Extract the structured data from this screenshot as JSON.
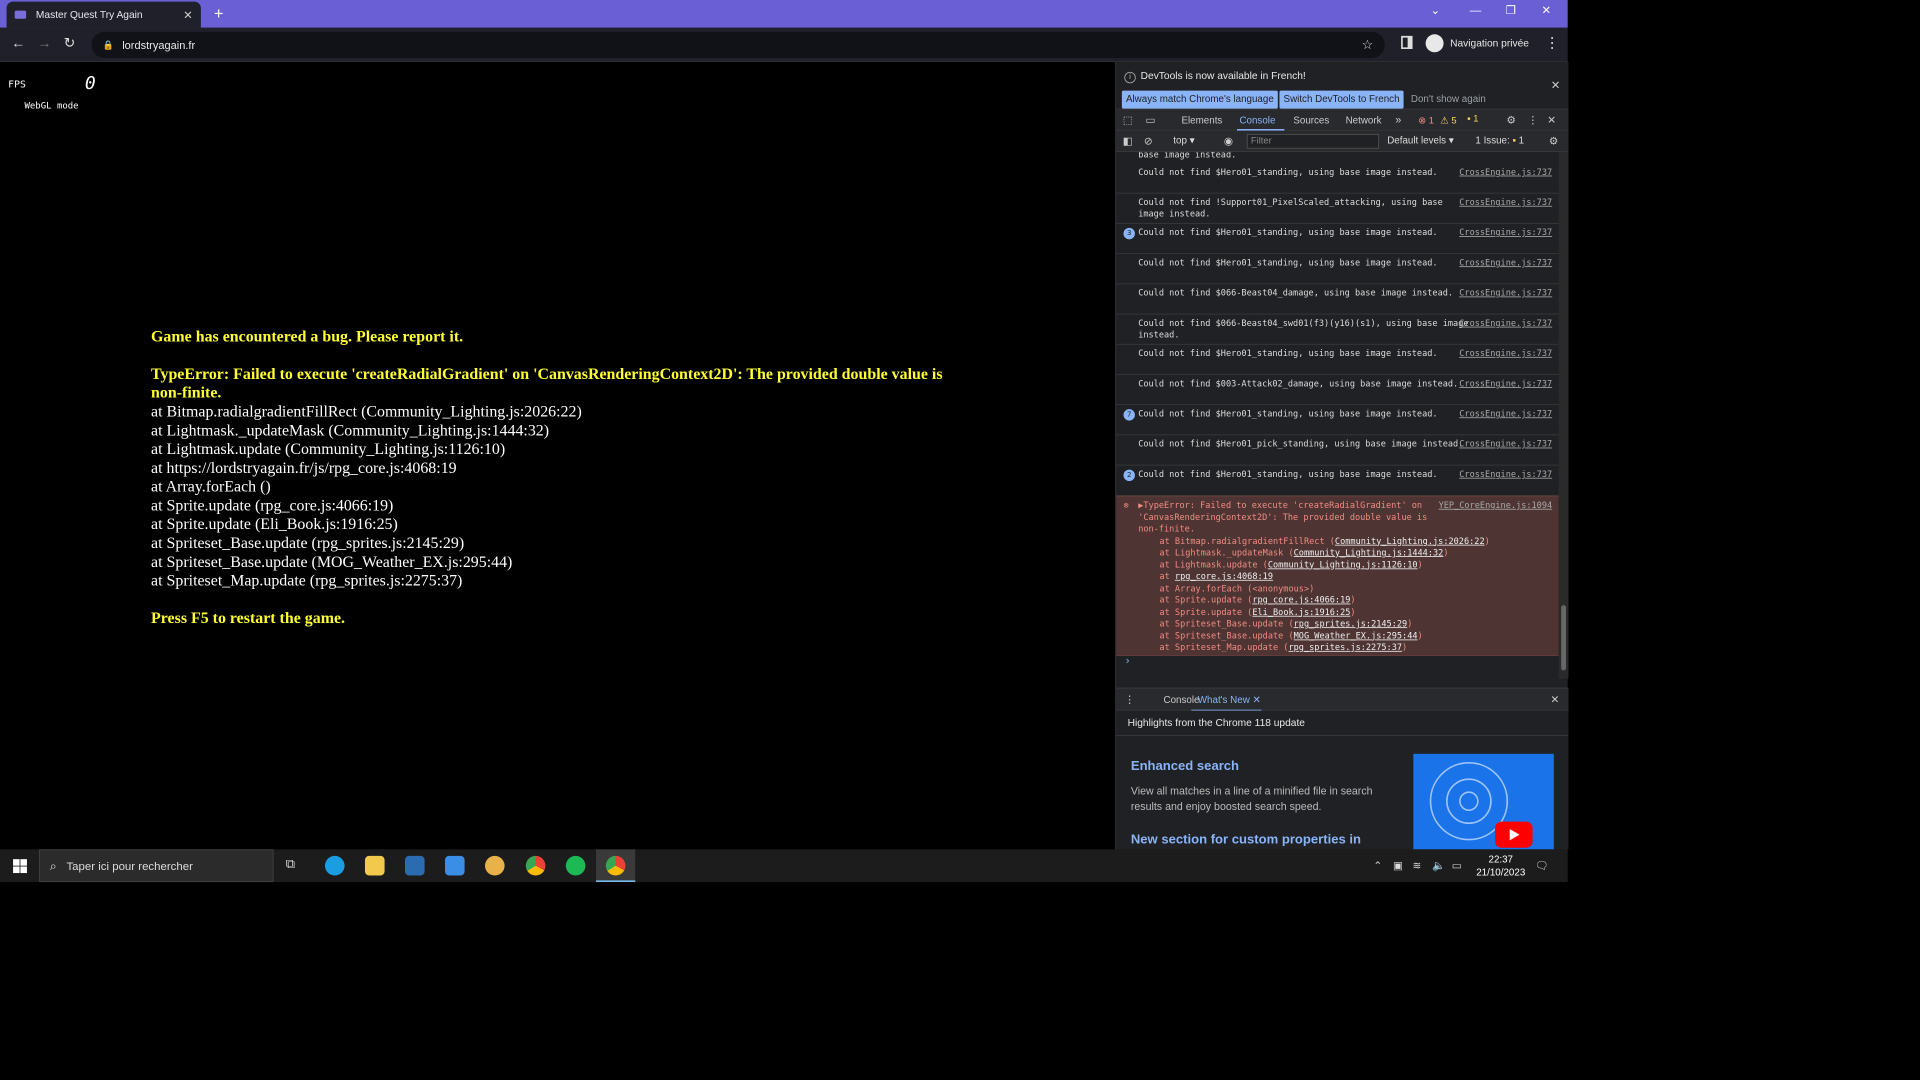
{
  "browser": {
    "tab_title": "Master Quest Try Again",
    "url": "lordstryagain.fr",
    "private_label": "Navigation privée"
  },
  "game": {
    "fps_label": "FPS",
    "fps_value": "0",
    "mode": "WebGL mode",
    "error_heading": "Game has encountered a bug. Please report it.",
    "error_message": "TypeError: Failed to execute 'createRadialGradient' on 'CanvasRenderingContext2D': The provided double value is non-finite.",
    "stack": [
      "at Bitmap.radialgradientFillRect (Community_Lighting.js:2026:22)",
      "at Lightmask._updateMask (Community_Lighting.js:1444:32)",
      "at Lightmask.update (Community_Lighting.js:1126:10)",
      "at https://lordstryagain.fr/js/rpg_core.js:4068:19",
      "at Array.forEach ()",
      "at Sprite.update (rpg_core.js:4066:19)",
      "at Sprite.update (Eli_Book.js:1916:25)",
      "at Spriteset_Base.update (rpg_sprites.js:2145:29)",
      "at Spriteset_Base.update (MOG_Weather_EX.js:295:44)",
      "at Spriteset_Map.update (rpg_sprites.js:2275:37)"
    ],
    "restart_msg": "Press F5 to restart the game."
  },
  "devtools": {
    "notice": "DevTools is now available in French!",
    "btn_match": "Always match Chrome's language",
    "btn_switch": "Switch DevTools to French",
    "btn_dont": "Don't show again",
    "tabs": [
      "Elements",
      "Console",
      "Sources",
      "Network"
    ],
    "badge_errors": "1",
    "badge_warnings": "5",
    "badge_info": "1",
    "context": "top",
    "filter_placeholder": "Filter",
    "levels": "Default levels",
    "issues": "1 Issue:",
    "issues_count": "1",
    "partial_line": "base image instead.",
    "messages": [
      {
        "count": "",
        "text": "Could not find $Hero01_standing, using base image instead.",
        "src": "CrossEngine.js:737"
      },
      {
        "count": "",
        "text": "Could not find !Support01_PixelScaled_attacking, using base image instead.",
        "src": "CrossEngine.js:737"
      },
      {
        "count": "3",
        "text": "Could not find $Hero01_standing, using base image instead.",
        "src": "CrossEngine.js:737"
      },
      {
        "count": "",
        "text": "Could not find $Hero01_standing, using base image instead.",
        "src": "CrossEngine.js:737"
      },
      {
        "count": "",
        "text": "Could not find $066-Beast04_damage, using base image instead.",
        "src": "CrossEngine.js:737"
      },
      {
        "count": "",
        "text": "Could not find $066-Beast04_swd01(f3)(y16)(s1), using base image instead.",
        "src": "CrossEngine.js:737"
      },
      {
        "count": "",
        "text": "Could not find $Hero01_standing, using base image instead.",
        "src": "CrossEngine.js:737"
      },
      {
        "count": "",
        "text": "Could not find $003-Attack02_damage, using base image instead.",
        "src": "CrossEngine.js:737"
      },
      {
        "count": "7",
        "text": "Could not find $Hero01_standing, using base image instead.",
        "src": "CrossEngine.js:737"
      },
      {
        "count": "",
        "text": "Could not find $Hero01_pick_standing, using base image instead.",
        "src": "CrossEngine.js:737"
      },
      {
        "count": "2",
        "text": "Could not find $Hero01_standing, using base image instead.",
        "src": "CrossEngine.js:737"
      }
    ],
    "error_entry": {
      "text": "TypeError: Failed to execute 'createRadialGradient' on 'CanvasRenderingContext2D': The provided double value is non-finite.",
      "src": "YEP_CoreEngine.js:1094",
      "stack": [
        [
          "at Bitmap.radialgradientFillRect (",
          "Community_Lighting.js:2026:22",
          ")"
        ],
        [
          "at Lightmask._updateMask (",
          "Community_Lighting.js:1444:32",
          ")"
        ],
        [
          "at Lightmask.update (",
          "Community_Lighting.js:1126:10",
          ")"
        ],
        [
          "at ",
          "rpg_core.js:4068:19",
          ""
        ],
        [
          "at Array.forEach (<anonymous>)",
          "",
          ""
        ],
        [
          "at Sprite.update (",
          "rpg_core.js:4066:19",
          ")"
        ],
        [
          "at Sprite.update (",
          "Eli_Book.js:1916:25",
          ")"
        ],
        [
          "at Spriteset_Base.update (",
          "rpg_sprites.js:2145:29",
          ")"
        ],
        [
          "at Spriteset_Base.update (",
          "MOG_Weather_EX.js:295:44",
          ")"
        ],
        [
          "at Spriteset_Map.update (",
          "rpg_sprites.js:2275:37",
          ")"
        ]
      ]
    },
    "drawer_tabs": [
      "Console",
      "What's New"
    ],
    "highlights": "Highlights from the Chrome 118 update",
    "whatsnew_title": "Enhanced search",
    "whatsnew_body": "View all matches in a line of a minified file in search results and enjoy boosted search speed.",
    "whatsnew_next": "New section for custom properties in"
  },
  "taskbar": {
    "search_placeholder": "Taper ici pour rechercher",
    "time": "22:37",
    "date": "21/10/2023"
  }
}
